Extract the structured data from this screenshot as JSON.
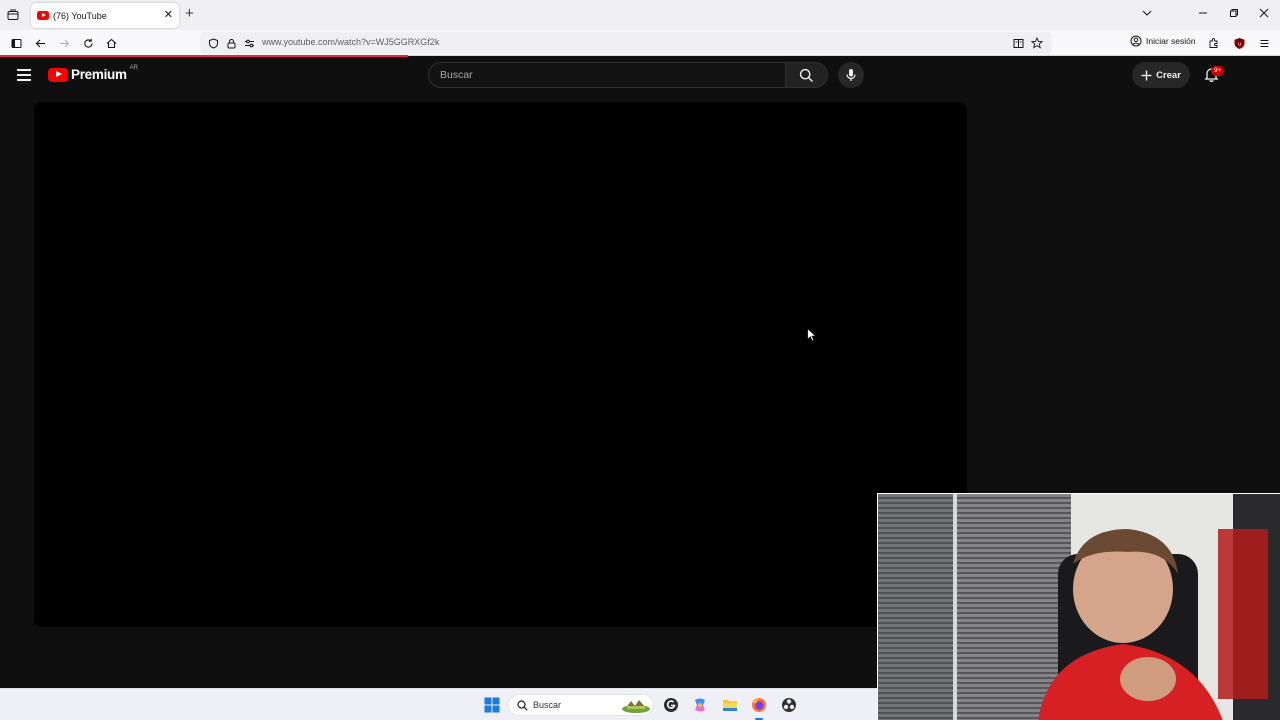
{
  "browser": {
    "tab": {
      "title": "(76) YouTube"
    },
    "url": "www.youtube.com/watch?v=WJ5GGRXGf2k",
    "signin_label": "Iniciar sesión"
  },
  "youtube": {
    "logo_text": "Premium",
    "country_code": "AR",
    "search_placeholder": "Buscar",
    "create_label": "Crear",
    "notification_badge": "9+"
  },
  "taskbar": {
    "search_label": "Buscar"
  },
  "colors": {
    "brand_red": "#ff0000",
    "page_bg": "#0f0f0f",
    "badge_red": "#cc0000",
    "loading_bar": "#e22850"
  },
  "icons": [
    "tab-list-icon",
    "youtube-favicon",
    "close-icon",
    "plus-icon",
    "chevron-down-icon",
    "minimize-icon",
    "restore-icon",
    "sidebar-icon",
    "back-icon",
    "forward-icon",
    "reload-icon",
    "home-icon",
    "shield-icon",
    "lock-icon",
    "permissions-icon",
    "reader-view-icon",
    "bookmark-star-icon",
    "account-icon",
    "extensions-icon",
    "ublock-icon",
    "menu-icon",
    "hamburger-icon",
    "search-icon",
    "mic-icon",
    "bell-icon",
    "windows-start-icon",
    "widgets-icon",
    "copilot-icon",
    "file-explorer-icon",
    "firefox-icon",
    "obs-icon"
  ]
}
